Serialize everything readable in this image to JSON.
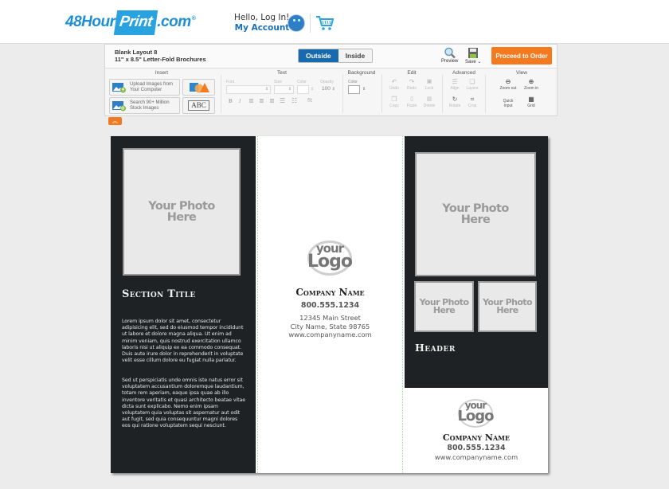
{
  "site": {
    "logo_prefix": "48Hour",
    "logo_print": "Print",
    "logo_suffix": ".com",
    "logo_reg": "®",
    "greeting": "Hello, Log In!",
    "account_link": "My Account"
  },
  "editor": {
    "layout_name": "Blank Layout 8",
    "layout_size": "11\" x 8.5\" Letter-Fold Brochures",
    "view_tabs": [
      {
        "label": "Outside",
        "active": true
      },
      {
        "label": "Inside",
        "active": false
      }
    ],
    "preview_label": "Preview",
    "save_label": "Save",
    "proceed_label": "Proceed to Order",
    "collapse_icon": "chevron-double-up",
    "groups": {
      "insert": {
        "title": "Insert",
        "upload_label_1": "Upload Images from",
        "upload_label_2": "Your Computer",
        "search_label_1": "Search 90+ Million",
        "search_label_2": "Stock Images",
        "text_button": "ABC"
      },
      "text": {
        "title": "Text",
        "font_label": "Font",
        "size_label": "Size",
        "color_label": "Color",
        "opacity_label": "Opacity",
        "opacity_value": "100",
        "format_buttons": [
          "B",
          "I",
          "align-left",
          "align-center",
          "align-right",
          "bullet-list",
          "numbered-list",
          "fit"
        ],
        "fit_label": "fit"
      },
      "background": {
        "title": "Background",
        "color_label": "Color"
      },
      "edit": {
        "title": "Edit",
        "tools": [
          {
            "label": "Undo",
            "icon": "↶"
          },
          {
            "label": "Redo",
            "icon": "↷"
          },
          {
            "label": "Lock",
            "icon": "🔒"
          },
          {
            "label": "Copy",
            "icon": "❐"
          },
          {
            "label": "Paste",
            "icon": "📋"
          },
          {
            "label": "Delete",
            "icon": "🗑"
          }
        ]
      },
      "advanced": {
        "title": "Advanced",
        "tools": [
          {
            "label": "Align",
            "icon": "☰"
          },
          {
            "label": "Layers",
            "icon": "❏"
          },
          {
            "label": "Rotate",
            "icon": "↻"
          },
          {
            "label": "Crop",
            "icon": "⌗"
          }
        ]
      },
      "view": {
        "title": "View",
        "tools": [
          {
            "label": "Zoom out",
            "icon": "⊖"
          },
          {
            "label": "Zoom in",
            "icon": "⊕"
          },
          {
            "label": "Quick Input",
            "label_1": "Quick",
            "label_2": "Input"
          },
          {
            "label": "Grid",
            "icon": "▦"
          }
        ]
      }
    }
  },
  "brochure": {
    "photo_placeholder_1": "Your Photo",
    "photo_placeholder_2": "Here",
    "left_panel": {
      "section_title": "Section Title",
      "paragraph_1": "Lorem ipsum dolor sit amet, consectetur adipisicing elit, sed do eiusmod tempor incididunt ut labore et dolore magna aliqua. Ut enim ad minim veniam, quis nostrud exercitation ullamco laboris nisi ut aliquip ex ea commodo consequat. Duis aute irure dolor in reprehenderit in voluptate velit esse cillum dolore eu fugiat nulla pariatur.",
      "paragraph_2": "Sed ut perspiciatis unde omnis iste natus error sit voluptatem accusantium doloremque laudantium, totam rem aperiam, eaque ipsa quae ab illo inventore veritatis et quasi architecto beatae vitae dicta sunt explicabo. Nemo enim ipsam voluptatem quia voluptas sit aspernatur aut odit aut fugit, sed quia consequuntur magni dolores eos qui ratione voluptatem sequi nesciunt."
    },
    "middle_panel": {
      "logo_top": "your",
      "logo_bottom": "Logo",
      "company_name": "Company Name",
      "phone": "800.555.1234",
      "address_line": "12345 Main Street",
      "city_line": "City Name, State 98765",
      "website": "www.companyname.com"
    },
    "right_panel": {
      "header": "Header",
      "logo_top": "your",
      "logo_bottom": "Logo",
      "company_name": "Company Name",
      "phone": "800.555.1234",
      "website": "www.companyname.com"
    }
  }
}
